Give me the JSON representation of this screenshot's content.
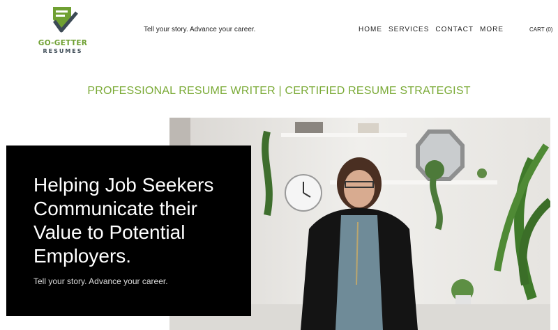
{
  "brand": {
    "line1": "GO-GETTER",
    "line2": "RESUMES",
    "accent_color": "#6fa032",
    "dark_color": "#3c4a55",
    "logo_icon": "shield-check-icon"
  },
  "header": {
    "tagline": "Tell your story. Advance your career.",
    "nav": [
      "HOME",
      "SERVICES",
      "CONTACT",
      "MORE"
    ],
    "cart_label": "CART (0)"
  },
  "headline": "PROFESSIONAL RESUME WRITER | CERTIFIED RESUME STRATEGIST",
  "hero": {
    "title": "Helping Job Seekers Communicate their Value to Potential Employers.",
    "subtitle": "Tell your story. Advance your career.",
    "box_color": "#000000",
    "photo": "portrait-photo"
  }
}
